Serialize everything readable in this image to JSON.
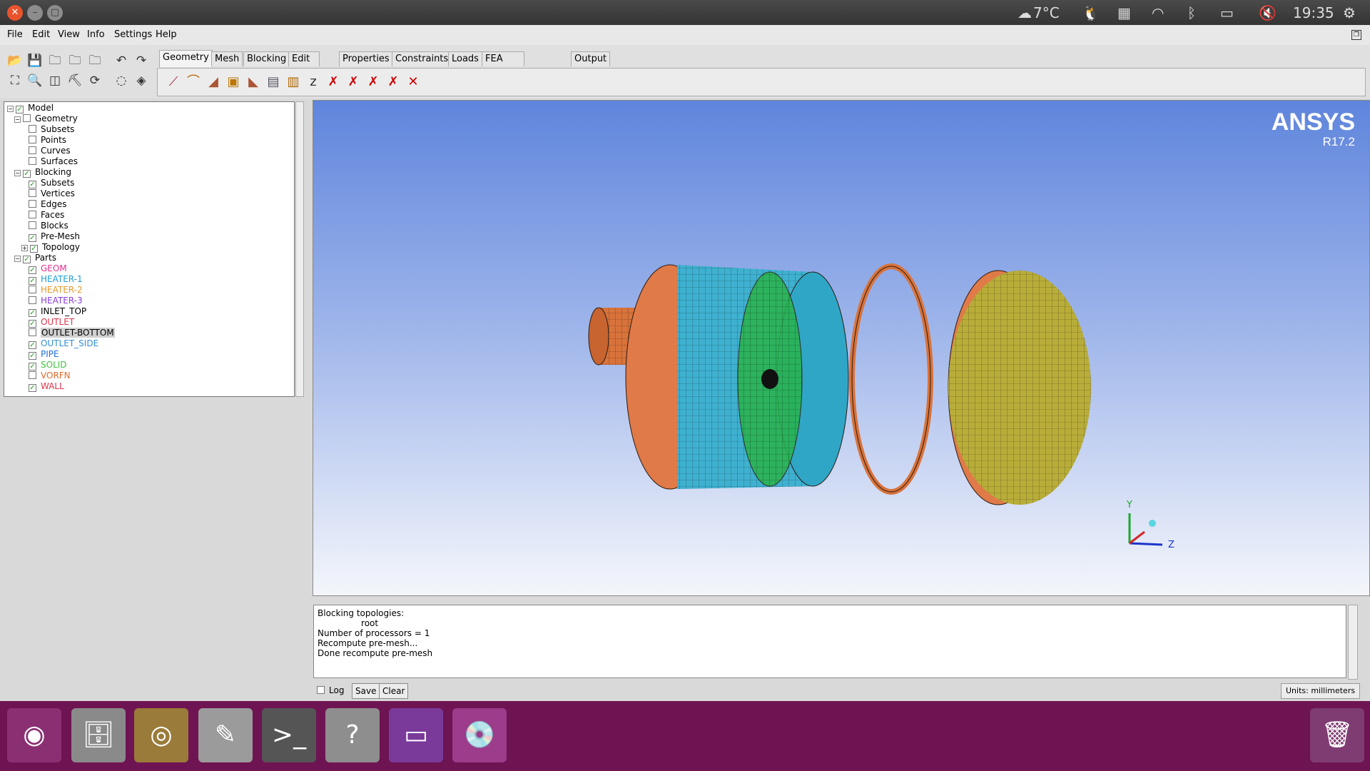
{
  "topbar": {
    "temperature": "7°C",
    "clock": "19:35"
  },
  "menu": [
    "File",
    "Edit",
    "View",
    "Info",
    "Settings",
    "Help"
  ],
  "tabs": [
    "Geometry",
    "Mesh",
    "Blocking",
    "Edit Mesh",
    "Properties",
    "Constraints",
    "Loads",
    "FEA Solve Options",
    "Output Mesh"
  ],
  "tree": {
    "model": "Model",
    "geometry": "Geometry",
    "geometry_items": [
      "Subsets",
      "Points",
      "Curves",
      "Surfaces"
    ],
    "blocking": "Blocking",
    "blocking_items": [
      "Subsets",
      "Vertices",
      "Edges",
      "Faces",
      "Blocks",
      "Pre-Mesh",
      "Topology"
    ],
    "parts": "Parts",
    "parts_items": [
      "GEOM",
      "HEATER-1",
      "HEATER-2",
      "HEATER-3",
      "INLET_TOP",
      "OUTLET",
      "OUTLET-BOTTOM",
      "OUTLET_SIDE",
      "PIPE",
      "SOLID",
      "VORFN",
      "WALL"
    ]
  },
  "viewport": {
    "brand": "ANSYS",
    "version": "R17.2",
    "axis_y": "Y",
    "axis_z": "Z"
  },
  "log": {
    "lines": "Blocking topologies:\n                root\nNumber of processors = 1\nRecompute pre-mesh...\nDone recompute pre-mesh",
    "log_label": "Log",
    "save_label": "Save",
    "clear_label": "Clear",
    "units": "Units: millimeters"
  }
}
